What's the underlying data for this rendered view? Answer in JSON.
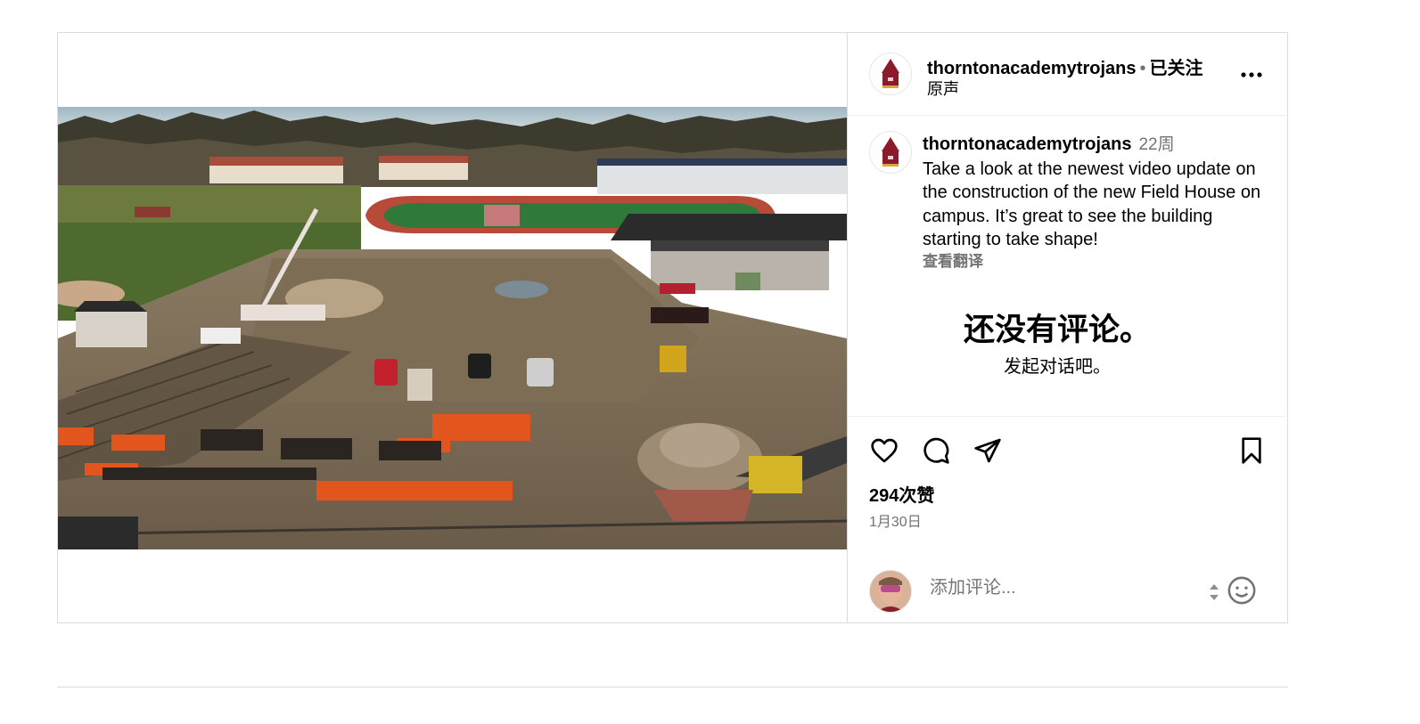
{
  "post": {
    "username": "thorntonacademytrojans",
    "follow_status": "已关注",
    "audio": "原声",
    "caption": {
      "username": "thorntonacademytrojans",
      "time_ago": "22周",
      "text": "Take a look at the newest video update on the construction of the new Field House on campus. It’s great to see the building starting to take shape!",
      "translate_label": "查看翻译"
    },
    "no_comments_title": "还没有评论。",
    "no_comments_subtitle": "发起对话吧。",
    "likes": "294次赞",
    "date": "1月30日",
    "comment_placeholder": "添加评论..."
  },
  "icons": {
    "brand_color": "#8b1a2b",
    "mute": "speaker-muted-icon",
    "more": "more-options-icon",
    "like": "heart-icon",
    "comment": "comment-bubble-icon",
    "share": "paper-plane-icon",
    "save": "bookmark-icon",
    "emoji": "smiley-icon",
    "expand": "expand-arrows-icon"
  }
}
